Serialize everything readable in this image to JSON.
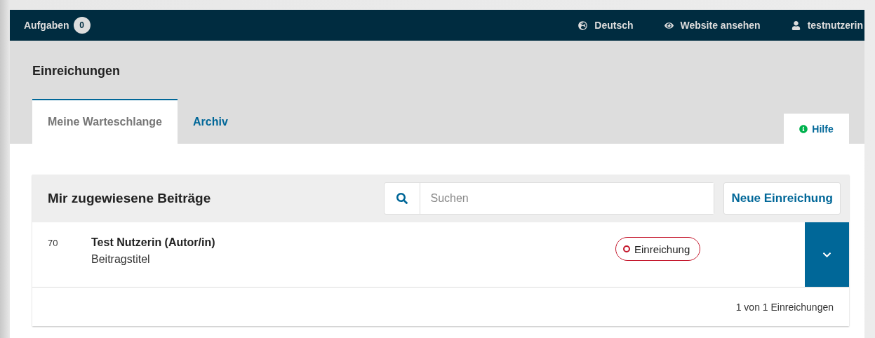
{
  "top_bar": {
    "tasks": {
      "label": "Aufgaben",
      "count": "0"
    },
    "links": [
      {
        "kind": "language",
        "label": "Deutsch"
      },
      {
        "kind": "view",
        "label": "Website ansehen"
      },
      {
        "kind": "user",
        "label": "testnutzerin"
      }
    ]
  },
  "page_title": "Einreichungen",
  "tabs": [
    {
      "label": "Meine Warteschlange",
      "selected": true
    },
    {
      "label": "Archiv",
      "selected": false
    }
  ],
  "help": {
    "label": "Hilfe"
  },
  "panel": {
    "title": "Mir zugewiesene Beiträge",
    "search": {
      "placeholder": "Suchen"
    },
    "new_button": "Neue Einreichung",
    "rows": [
      {
        "id": "70",
        "author": "Test Nutzerin (Autor/in)",
        "title": "Beitragstitel",
        "stage": {
          "label": "Einreichung",
          "color": "#c4162b"
        }
      }
    ],
    "footer": "1 von 1 Einreichungen"
  }
}
